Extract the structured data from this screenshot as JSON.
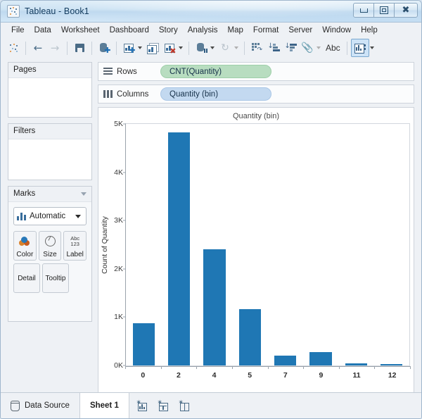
{
  "window": {
    "title": "Tableau - Book1",
    "app_icon": "tableau-logo-icon",
    "minimize_label": "Minimize",
    "maximize_label": "Maximize",
    "close_label": "Close"
  },
  "menubar": {
    "items": [
      {
        "label": "File"
      },
      {
        "label": "Data"
      },
      {
        "label": "Worksheet"
      },
      {
        "label": "Dashboard"
      },
      {
        "label": "Story"
      },
      {
        "label": "Analysis"
      },
      {
        "label": "Map"
      },
      {
        "label": "Format"
      },
      {
        "label": "Server"
      },
      {
        "label": "Window"
      },
      {
        "label": "Help"
      }
    ]
  },
  "toolbar": {
    "items": [
      {
        "name": "tableau-home-icon",
        "tip": "Tableau Home"
      },
      {
        "name": "back-arrow-icon",
        "tip": "Back"
      },
      {
        "name": "forward-arrow-icon",
        "tip": "Forward"
      },
      {
        "name": "save-icon",
        "tip": "Save"
      },
      {
        "name": "new-data-source-icon",
        "tip": "Connect to Data"
      },
      {
        "name": "new-worksheet-icon",
        "tip": "New Worksheet"
      },
      {
        "name": "duplicate-sheet-icon",
        "tip": "Duplicate Sheet"
      },
      {
        "name": "clear-sheet-icon",
        "tip": "Clear Sheet"
      },
      {
        "name": "swap-rows-columns-icon",
        "tip": "Swap Rows and Columns"
      },
      {
        "name": "refresh-data-source-icon",
        "tip": "Refresh Data Source"
      },
      {
        "name": "pause-auto-updates-icon",
        "tip": "Pause Auto Updates"
      },
      {
        "name": "sort-ascending-icon",
        "tip": "Sort Ascending"
      },
      {
        "name": "sort-descending-icon",
        "tip": "Sort Descending"
      },
      {
        "name": "highlight-icon",
        "tip": "Highlight"
      },
      {
        "name": "show-mark-labels-icon",
        "tip": "Show Mark Labels"
      },
      {
        "name": "show-me-icon",
        "tip": "Show Me"
      }
    ],
    "show_me_label": "Abc",
    "show_me_selected": true
  },
  "left_panel": {
    "pages": {
      "title": "Pages"
    },
    "filters": {
      "title": "Filters"
    },
    "marks": {
      "title": "Marks",
      "mark_type": "Automatic",
      "buttons": [
        {
          "label": "Color",
          "icon": "color-palette-icon"
        },
        {
          "label": "Size",
          "icon": "size-circle-icon"
        },
        {
          "label": "Label",
          "icon": "abc-123-icon"
        },
        {
          "label": "Detail",
          "icon": "detail-icon"
        },
        {
          "label": "Tooltip",
          "icon": "tooltip-icon"
        }
      ]
    }
  },
  "shelves": {
    "rows": {
      "label": "Rows",
      "pill": "CNT(Quantity)",
      "pill_color": "#b8ddc0"
    },
    "columns": {
      "label": "Columns",
      "pill": "Quantity (bin)",
      "pill_color": "#c3d9f0"
    }
  },
  "chart_data": {
    "type": "bar",
    "title": "Quantity (bin)",
    "xlabel": "",
    "ylabel": "Count of Quantity",
    "categories": [
      "0",
      "2",
      "4",
      "5",
      "7",
      "9",
      "11",
      "12"
    ],
    "values": [
      880,
      4820,
      2400,
      1170,
      200,
      270,
      45,
      35
    ],
    "ylim": [
      0,
      5000
    ],
    "yticks": [
      {
        "value": 0,
        "label": "0K"
      },
      {
        "value": 1000,
        "label": "1K"
      },
      {
        "value": 2000,
        "label": "2K"
      },
      {
        "value": 3000,
        "label": "3K"
      },
      {
        "value": 4000,
        "label": "4K"
      },
      {
        "value": 5000,
        "label": "5K"
      }
    ],
    "bar_color": "#1f77b4",
    "grid": false,
    "legend": "none"
  },
  "statusbar": {
    "data_source_label": "Data Source",
    "sheet_tab_label": "Sheet 1",
    "new_buttons": [
      {
        "name": "new-worksheet-tab-icon",
        "label": "New Worksheet"
      },
      {
        "name": "new-dashboard-tab-icon",
        "label": "New Dashboard"
      },
      {
        "name": "new-story-tab-icon",
        "label": "New Story"
      }
    ]
  }
}
